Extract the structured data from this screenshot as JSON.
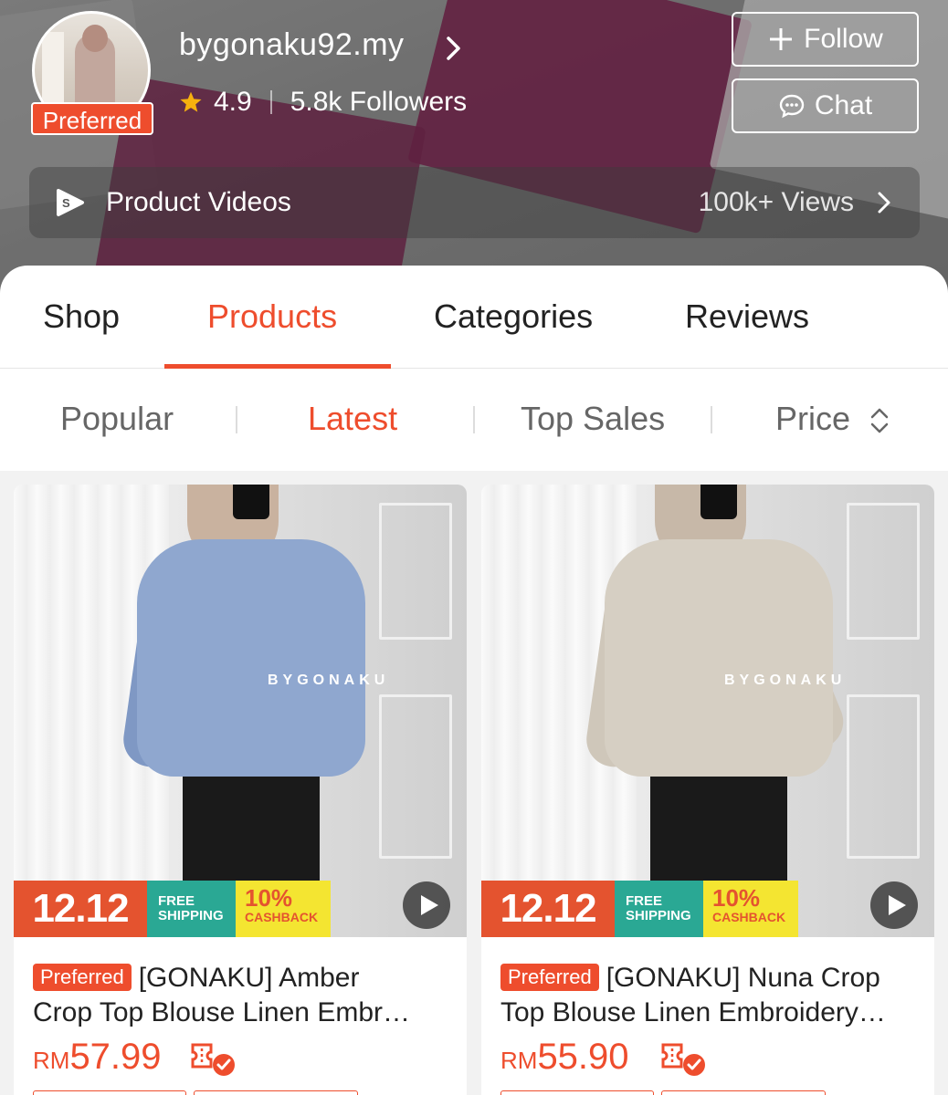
{
  "header": {
    "shop_name": "bygonaku92.my",
    "badge": "Preferred",
    "rating": "4.9",
    "followers": "5.8k Followers",
    "follow_label": "Follow",
    "chat_label": "Chat",
    "videos_label": "Product Videos",
    "videos_views": "100k+ Views"
  },
  "tabs": [
    {
      "label": "Shop",
      "active": false
    },
    {
      "label": "Products",
      "active": true
    },
    {
      "label": "Categories",
      "active": false
    },
    {
      "label": "Reviews",
      "active": false
    }
  ],
  "sort_options": [
    {
      "label": "Popular",
      "active": false
    },
    {
      "label": "Latest",
      "active": true
    },
    {
      "label": "Top Sales",
      "active": false
    },
    {
      "label": "Price",
      "active": false
    }
  ],
  "products": [
    {
      "badge": "Preferred",
      "title_line1": "[GONAKU] Amber",
      "title_line2": "Crop Top Blouse Linen Embr…",
      "currency": "RM",
      "price": "57.99",
      "watermark": "BYGONAKU",
      "promo": {
        "sale": "12.12",
        "shipping": "FREE SHIPPING",
        "cashback_pct": "10%",
        "cashback": "CASHBACK"
      },
      "color": "#8fa7cf"
    },
    {
      "badge": "Preferred",
      "title_line1": "[GONAKU] Nuna Crop",
      "title_line2": "Top Blouse Linen Embroidery…",
      "currency": "RM",
      "price": "55.90",
      "watermark": "BYGONAKU",
      "promo": {
        "sale": "12.12",
        "shipping": "FREE SHIPPING",
        "cashback_pct": "10%",
        "cashback": "CASHBACK"
      },
      "color": "#d6cfc3"
    }
  ],
  "colors": {
    "accent": "#ee4d2d",
    "promo_green": "#2aa894",
    "promo_yellow": "#f4e531"
  }
}
